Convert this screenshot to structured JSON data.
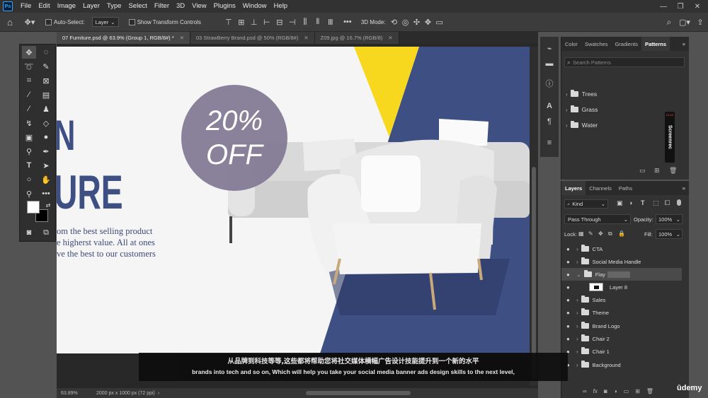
{
  "menubar": {
    "logo": "Ps",
    "items": [
      "File",
      "Edit",
      "Image",
      "Layer",
      "Type",
      "Select",
      "Filter",
      "3D",
      "View",
      "Plugins",
      "Window",
      "Help"
    ]
  },
  "options": {
    "auto_select_label": "Auto-Select:",
    "auto_select_value": "Layer",
    "transform_label": "Show Transform Controls",
    "mode_3d_label": "3D Mode:"
  },
  "doc_tabs": [
    {
      "label": "07 Furniture.psd @ 63.9% (Group 1, RGB/8#) *"
    },
    {
      "label": "03 StrawBerry Brand.psd @ 50% (RGB/8#)"
    },
    {
      "label": "Z09.jpg @ 16.7% (RGB/8)"
    }
  ],
  "artboard": {
    "badge_line1": "20%",
    "badge_line2": "OFF",
    "headline1": "N",
    "headline2": "URE",
    "body1": "om the best selling product",
    "body2": "e higherst value. All at ones",
    "body3": "ve the best to our customers"
  },
  "status": {
    "zoom": "63.89%",
    "doc_size": "2000 px x 1000 px (72 ppi)"
  },
  "top_panel": {
    "tabs": [
      "Color",
      "Swatches",
      "Gradients",
      "Patterns"
    ],
    "active_tab": "Patterns",
    "search_placeholder": "Search Patterns",
    "groups": [
      "Trees",
      "Grass",
      "Water"
    ]
  },
  "layers_panel": {
    "tabs": [
      "Layers",
      "Channels",
      "Paths"
    ],
    "active_tab": "Layers",
    "filter_label": "Kind",
    "blend_mode": "Pass Through",
    "opacity_label": "Opacity:",
    "opacity_value": "100%",
    "lock_label": "Lock:",
    "fill_label": "Fill:",
    "fill_value": "100%",
    "layers": [
      {
        "name": "CTA",
        "type": "group"
      },
      {
        "name": "Social Media Handle",
        "type": "group"
      },
      {
        "name": "Flay",
        "type": "group",
        "selected": true
      },
      {
        "name": "Layer 8",
        "type": "layer"
      },
      {
        "name": "Sales",
        "type": "group"
      },
      {
        "name": "Theme",
        "type": "group"
      },
      {
        "name": "Brand Logo",
        "type": "group"
      },
      {
        "name": "Chair 2",
        "type": "group"
      },
      {
        "name": "Chair 1",
        "type": "group"
      },
      {
        "name": "Background",
        "type": "group"
      }
    ]
  },
  "recorder": {
    "label": "Screenrec",
    "time": "01:22"
  },
  "watermark": "ūdemy",
  "subtitles": {
    "zh": "从品牌到科技等等,这些都将帮助您将社交媒体横幅广告设计技能提升到一个新的水平",
    "en": "brands into tech and so on, Which will help you take your social media banner ads design skills to the next level,"
  },
  "colors": {
    "navy": "#3e4f83",
    "yellow": "#f7d81f",
    "badge": "#7e7490"
  }
}
